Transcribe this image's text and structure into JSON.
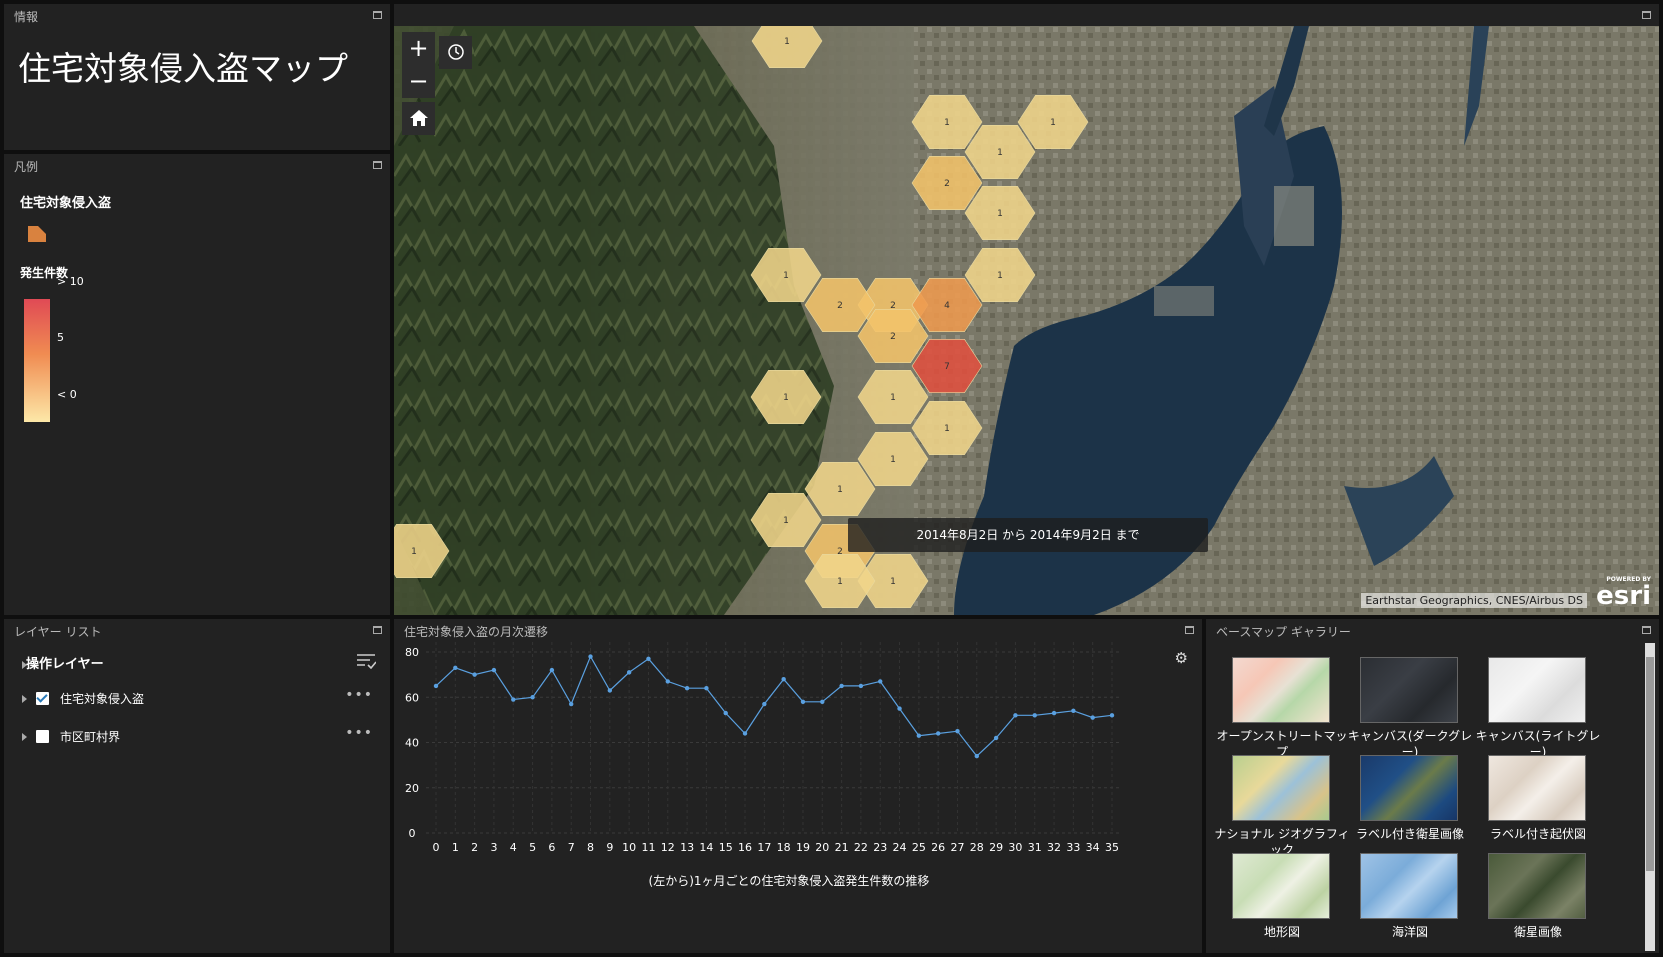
{
  "info": {
    "panel_title": "情報",
    "title": "住宅対象侵入盗マップ"
  },
  "legend": {
    "panel_title": "凡例",
    "layer_name": "住宅対象侵入盗",
    "field_name": "発生件数",
    "ramp_labels": [
      "> 10",
      "5",
      "< 0"
    ],
    "ramp_colors": [
      "#e04a55",
      "#f08c52",
      "#fde8a8"
    ],
    "swatch_color": "#d9823f"
  },
  "layer_list": {
    "panel_title": "レイヤー リスト",
    "heading": "操作レイヤー",
    "layers": [
      {
        "name": "住宅対象侵入盗",
        "checked": true
      },
      {
        "name": "市区町村界",
        "checked": false
      }
    ]
  },
  "map": {
    "time_extent": "2014年8月2日 から 2014年9月2日 まで",
    "attribution": "Earthstar Geographics, CNES/Airbus DS",
    "esri_small": "POWERED BY",
    "esri_big": "esri",
    "zoom_in": "+",
    "zoom_out": "−",
    "hex_counts": [
      "1",
      "1",
      "1",
      "1",
      "2",
      "1",
      "1",
      "1",
      "2",
      "2",
      "4",
      "1",
      "2",
      "7",
      "1",
      "1",
      "1",
      "1",
      "2",
      "1",
      "1",
      "1",
      "1"
    ]
  },
  "chart": {
    "panel_title": "住宅対象侵入盗の月次遷移",
    "chart_data": {
      "type": "line",
      "title": "(左から)1ヶ月ごとの住宅対象侵入盗発生件数の推移",
      "x": [
        0,
        1,
        2,
        3,
        4,
        5,
        6,
        7,
        8,
        9,
        10,
        11,
        12,
        13,
        14,
        15,
        16,
        17,
        18,
        19,
        20,
        21,
        22,
        23,
        24,
        25,
        26,
        27,
        28,
        29,
        30,
        31,
        32,
        33,
        34,
        35
      ],
      "values": [
        65,
        73,
        70,
        72,
        59,
        60,
        72,
        57,
        78,
        63,
        71,
        77,
        67,
        64,
        64,
        53,
        44,
        57,
        68,
        58,
        58,
        65,
        65,
        67,
        55,
        43,
        44,
        45,
        34,
        42,
        52,
        52,
        53,
        54,
        51,
        52
      ],
      "ylim": [
        0,
        80
      ],
      "yticks": [
        0,
        20,
        40,
        60,
        80
      ],
      "line_color": "#5aa0e0",
      "grid": true
    }
  },
  "gallery": {
    "panel_title": "ベースマップ ギャラリー",
    "items": [
      {
        "label": "オープンストリートマップ",
        "theme": "osm"
      },
      {
        "label": "キャンバス(ダークグレー)",
        "theme": "dark"
      },
      {
        "label": "キャンバス(ライトグレー)",
        "theme": "light"
      },
      {
        "label": "ナショナル ジオグラフィック",
        "theme": "natgeo"
      },
      {
        "label": "ラベル付き衛星画像",
        "theme": "hybrid"
      },
      {
        "label": "ラベル付き起伏図",
        "theme": "terrain"
      },
      {
        "label": "地形図",
        "theme": "topo"
      },
      {
        "label": "海洋図",
        "theme": "ocean"
      },
      {
        "label": "衛星画像",
        "theme": "imagery"
      }
    ]
  }
}
